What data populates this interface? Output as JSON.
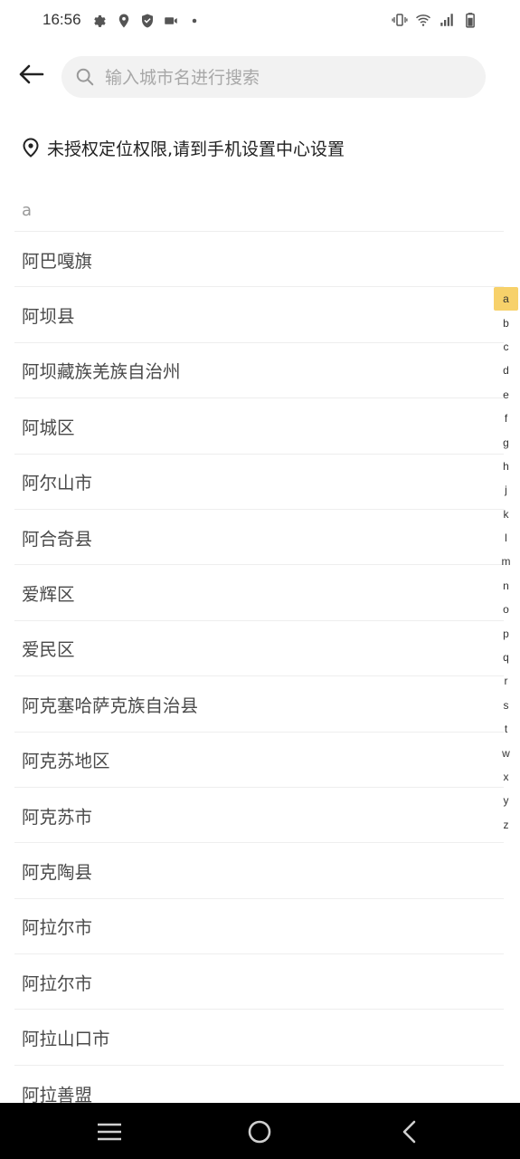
{
  "status_bar": {
    "time": "16:56",
    "left_icons": [
      "gear-icon",
      "location-pin-icon",
      "shield-icon",
      "video-icon",
      "dot-icon"
    ],
    "right_icons": [
      "vibrate-icon",
      "wifi-icon",
      "signal-icon",
      "battery-icon"
    ]
  },
  "search": {
    "placeholder": "输入城市名进行搜索",
    "value": ""
  },
  "location": {
    "notice": "未授权定位权限,请到手机设置中心设置"
  },
  "section": {
    "header": "a"
  },
  "cities": [
    "阿巴嘎旗",
    "阿坝县",
    "阿坝藏族羌族自治州",
    "阿城区",
    "阿尔山市",
    "阿合奇县",
    "爱辉区",
    "爱民区",
    "阿克塞哈萨克族自治县",
    "阿克苏地区",
    "阿克苏市",
    "阿克陶县",
    "阿拉尔市",
    "阿拉尔市",
    "阿拉山口市",
    "阿拉善盟"
  ],
  "alphabet_index": {
    "letters": [
      "a",
      "b",
      "c",
      "d",
      "e",
      "f",
      "g",
      "h",
      "j",
      "k",
      "l",
      "m",
      "n",
      "o",
      "p",
      "q",
      "r",
      "s",
      "t",
      "w",
      "x",
      "y",
      "z"
    ],
    "active": "a"
  },
  "colors": {
    "accent": "#f7d16a",
    "divider": "#eeeeee",
    "search_bg": "#f2f2f2",
    "nav_bar": "#000000"
  }
}
